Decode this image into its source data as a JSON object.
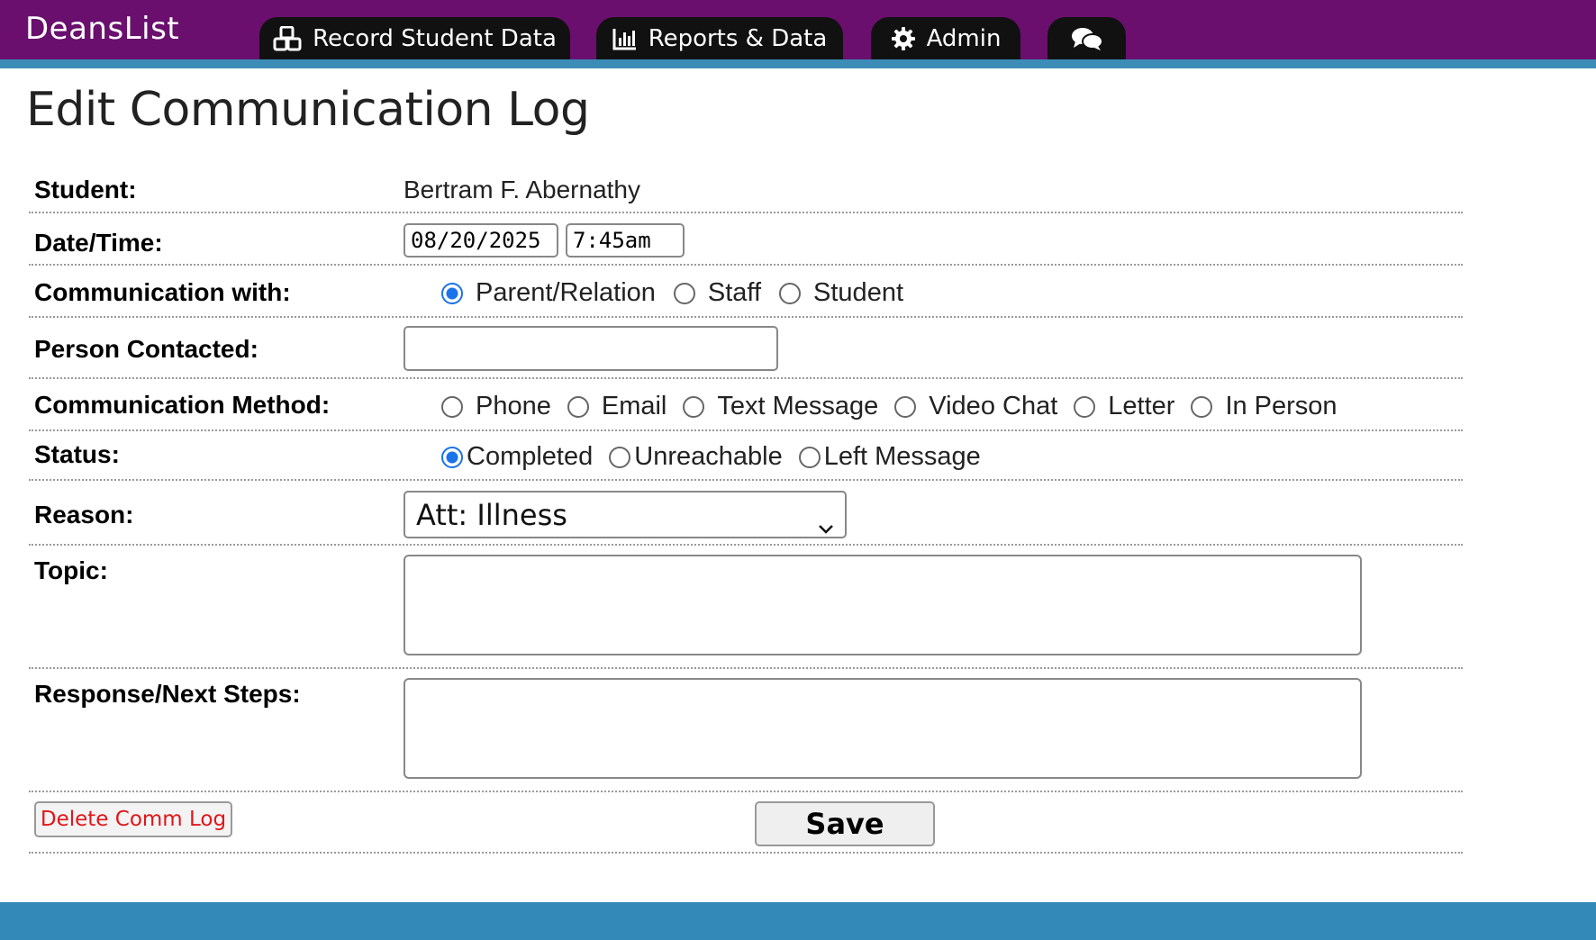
{
  "header": {
    "logo": "DeansList",
    "tabs": [
      {
        "label": "Record Student Data",
        "icon": "cubes-icon"
      },
      {
        "label": "Reports & Data",
        "icon": "bar-chart-icon"
      },
      {
        "label": "Admin",
        "icon": "gear-icon"
      },
      {
        "label": "",
        "icon": "chat-bubbles-icon"
      }
    ],
    "colors": {
      "bar": "#6a0f6e",
      "stripe": "#3b8db8",
      "tab": "#111111"
    }
  },
  "page": {
    "title": "Edit Communication Log"
  },
  "form": {
    "student": {
      "label": "Student:",
      "value": "Bertram F. Abernathy"
    },
    "datetime": {
      "label": "Date/Time:",
      "date": "08/20/2025",
      "time": "7:45am"
    },
    "comm_with": {
      "label": "Communication with:",
      "options": [
        "Parent/Relation",
        "Staff",
        "Student"
      ],
      "selected": "Parent/Relation"
    },
    "person_contacted": {
      "label": "Person Contacted:",
      "value": ""
    },
    "method": {
      "label": "Communication Method:",
      "options": [
        "Phone",
        "Email",
        "Text Message",
        "Video Chat",
        "Letter",
        "In Person"
      ],
      "selected": ""
    },
    "status": {
      "label": "Status:",
      "options": [
        "Completed",
        "Unreachable",
        "Left Message"
      ],
      "selected": "Completed"
    },
    "reason": {
      "label": "Reason:",
      "value": "Att: Illness"
    },
    "topic": {
      "label": "Topic:",
      "value": ""
    },
    "response": {
      "label": "Response/Next Steps:",
      "value": ""
    }
  },
  "actions": {
    "delete_label": "Delete Comm Log",
    "save_label": "Save"
  },
  "colors": {
    "radio_checked": "#1a73e8",
    "delete_text": "#e0161b",
    "footer": "#338ab8"
  }
}
